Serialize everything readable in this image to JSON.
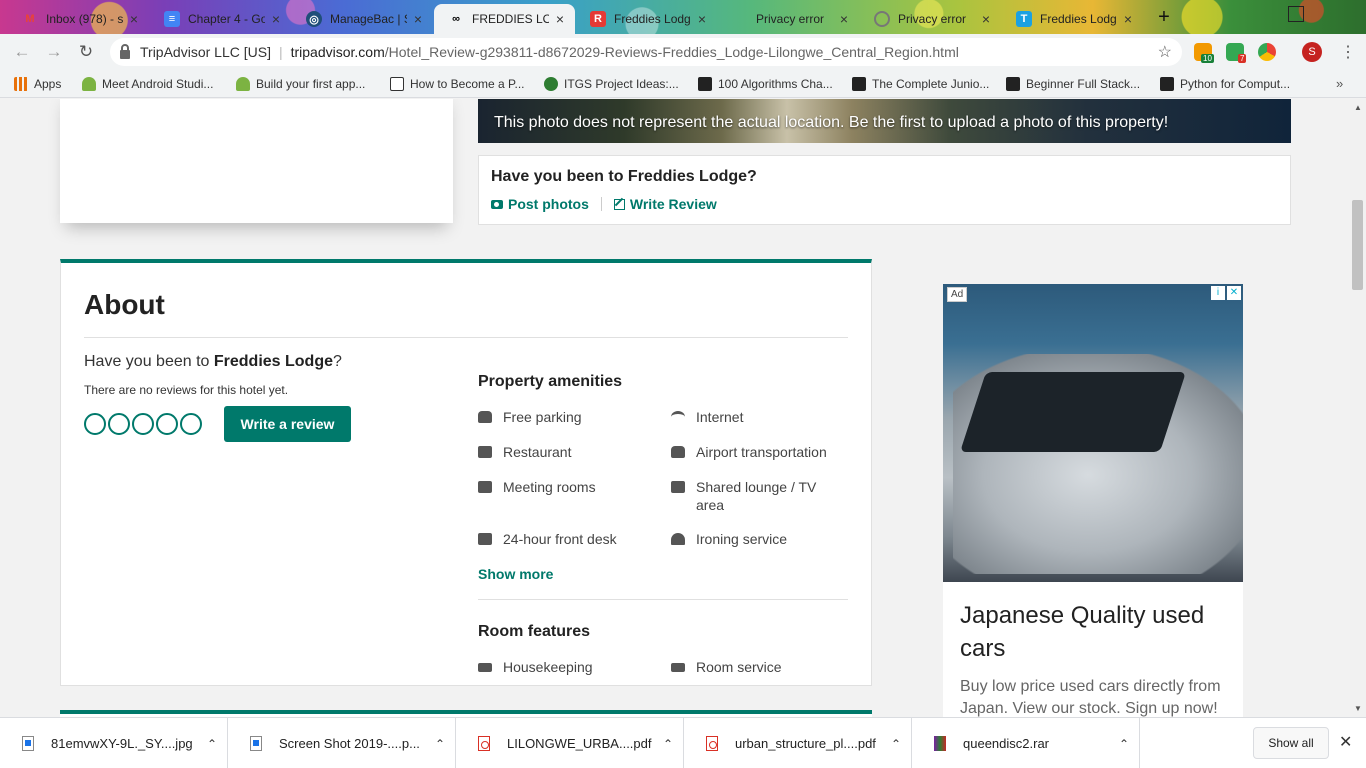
{
  "tabs": [
    {
      "title": "Inbox (978) - s",
      "icon": "gmail-icon",
      "color": "#ea4335",
      "glyph": "M"
    },
    {
      "title": "Chapter 4 - Go",
      "icon": "google-docs-icon",
      "color": "#4285f4",
      "glyph": "≡"
    },
    {
      "title": "ManageBac | S",
      "icon": "managebac-icon",
      "color": "#1f4e79",
      "glyph": "◎"
    },
    {
      "title": "FREDDIES LOD",
      "icon": "tripadvisor-icon",
      "color": "#000000",
      "glyph": "∞"
    },
    {
      "title": "Freddies Lodg",
      "icon": "r-icon",
      "color": "#e53935",
      "glyph": "R"
    },
    {
      "title": "Privacy error",
      "icon": "warning-icon",
      "color": "#888888",
      "glyph": ""
    },
    {
      "title": "Privacy error",
      "icon": "warning-icon",
      "color": "#888888",
      "glyph": ""
    },
    {
      "title": "Freddies Lodg",
      "icon": "t-icon",
      "color": "#1ba1e2",
      "glyph": "T"
    }
  ],
  "address": {
    "site_id": "TripAdvisor LLC [US]",
    "url_host": "tripadvisor.com",
    "url_path": "/Hotel_Review-g293811-d8672029-Reviews-Freddies_Lodge-Lilongwe_Central_Region.html"
  },
  "extensions": {
    "badge1": "10",
    "badge2": "7",
    "avatar": "S"
  },
  "bookmarks": [
    {
      "label": "Apps",
      "icon": "apps-grid-icon",
      "color": "#e8710a"
    },
    {
      "label": "Meet Android Studi...",
      "icon": "android-icon",
      "color": "#7cb342"
    },
    {
      "label": "Build your first app...",
      "icon": "android-icon",
      "color": "#7cb342"
    },
    {
      "label": "How to Become a P...",
      "icon": "id-card-icon",
      "color": "#333333"
    },
    {
      "label": "ITGS Project Ideas:...",
      "icon": "globe-icon",
      "color": "#2e7d32"
    },
    {
      "label": "100 Algorithms Cha...",
      "icon": "medium-icon",
      "color": "#222222"
    },
    {
      "label": "The Complete Junio...",
      "icon": "medium-icon",
      "color": "#222222"
    },
    {
      "label": "Beginner Full Stack...",
      "icon": "medium-icon",
      "color": "#222222"
    },
    {
      "label": "Python for Comput...",
      "icon": "medium-icon",
      "color": "#222222"
    }
  ],
  "photo_note": "This photo does not represent the actual location. Be the first to upload a photo of this property!",
  "been_card": {
    "title": "Have you been to Freddies Lodge?",
    "post_photos": "Post photos",
    "write_review": "Write Review"
  },
  "about": {
    "title": "About",
    "question_prefix": "Have you been to ",
    "hotel_name": "Freddies Lodge",
    "question_suffix": "?",
    "no_reviews": "There are no reviews for this hotel yet.",
    "write_review_btn": "Write a review",
    "amenities_heading": "Property amenities",
    "amenities": [
      {
        "label": "Free parking",
        "icon": "car-icon"
      },
      {
        "label": "Internet",
        "icon": "wifi-icon"
      },
      {
        "label": "Restaurant",
        "icon": "restaurant-icon"
      },
      {
        "label": "Airport transportation",
        "icon": "shuttle-icon"
      },
      {
        "label": "Meeting rooms",
        "icon": "meeting-room-icon"
      },
      {
        "label": "Shared lounge / TV area",
        "icon": "lounge-icon"
      },
      {
        "label": "24-hour front desk",
        "icon": "front-desk-icon"
      },
      {
        "label": "Ironing service",
        "icon": "iron-icon"
      }
    ],
    "show_more": "Show more",
    "room_features_heading": "Room features",
    "room_features": [
      {
        "label": "Housekeeping",
        "icon": "bed-icon"
      },
      {
        "label": "Room service",
        "icon": "bed-icon"
      }
    ]
  },
  "ad": {
    "label": "Ad",
    "title": "Japanese Quality used cars",
    "description": "Buy low price used cars directly from Japan. View our stock. Sign up now!"
  },
  "downloads": [
    {
      "name": "81emvwXY-9L._SY....jpg",
      "type": "img"
    },
    {
      "name": "Screen Shot 2019-....p...",
      "type": "img"
    },
    {
      "name": "LILONGWE_URBA....pdf",
      "type": "pdf"
    },
    {
      "name": "urban_structure_pl....pdf",
      "type": "pdf"
    },
    {
      "name": "queendisc2.rar",
      "type": "rar"
    }
  ],
  "show_all": "Show all",
  "colors": {
    "brand": "#00796b"
  }
}
